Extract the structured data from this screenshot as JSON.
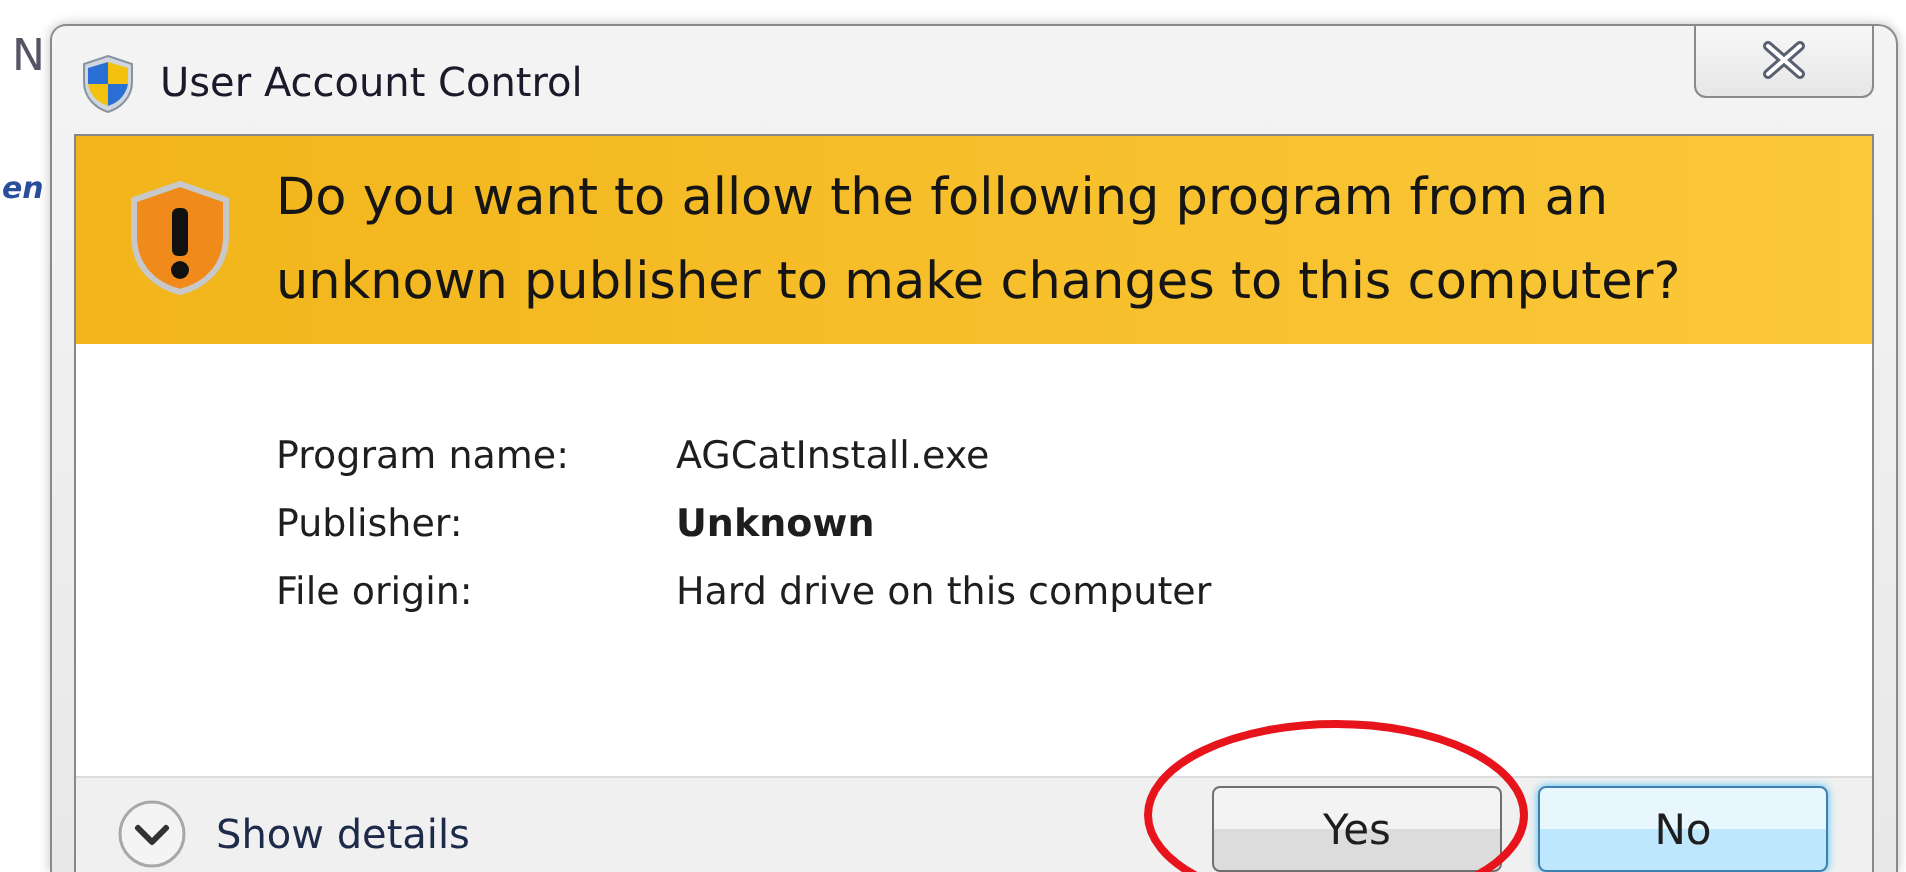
{
  "background_fragments": [
    {
      "text": "N",
      "kind": "plain"
    },
    {
      "text": "en",
      "kind": "link"
    }
  ],
  "window": {
    "title": "User Account Control"
  },
  "heading": "Do you want to allow the following program from an unknown publisher to make changes to this computer?",
  "details": [
    {
      "label": "Program name:",
      "value": "AGCatInstall.exe",
      "bold": false
    },
    {
      "label": "Publisher:",
      "value": "Unknown",
      "bold": true
    },
    {
      "label": "File origin:",
      "value": "Hard drive on this computer",
      "bold": false
    }
  ],
  "footer": {
    "toggle": "Show details",
    "expanded": false
  },
  "buttons": [
    {
      "label": "Yes",
      "default": false,
      "circled": true
    },
    {
      "label": "No",
      "default": true,
      "circled": false
    }
  ]
}
